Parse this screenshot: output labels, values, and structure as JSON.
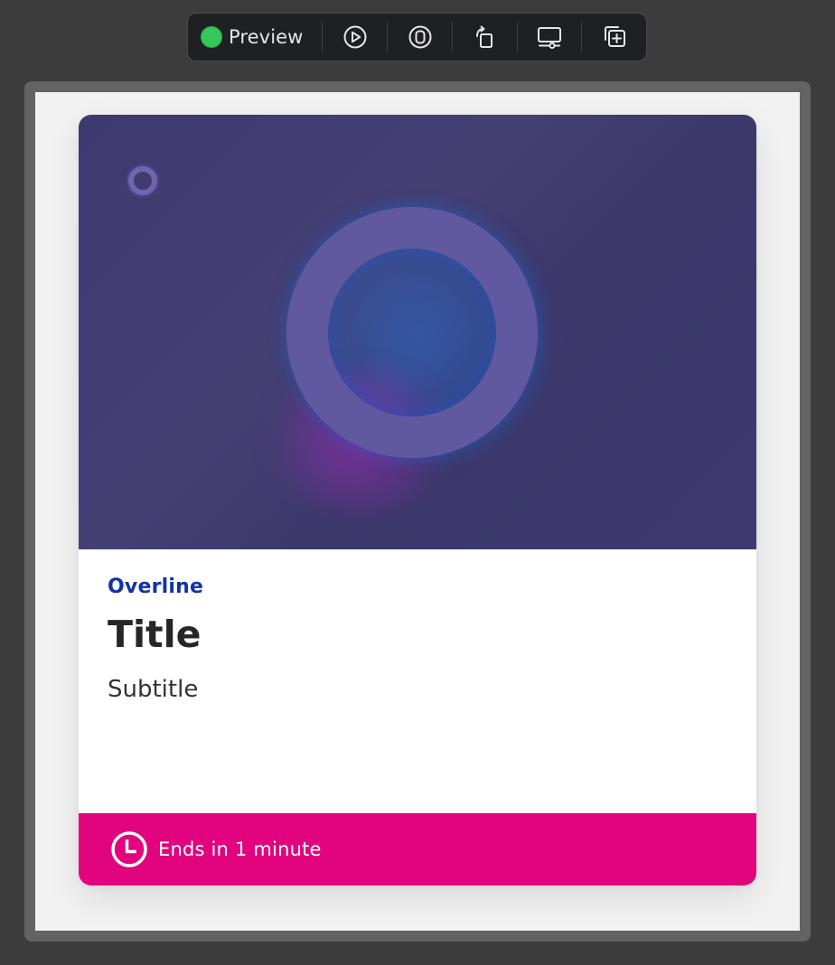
{
  "toolbar": {
    "preview_label": "Preview",
    "status_color": "#34c759",
    "buttons": [
      {
        "icon": "play-icon"
      },
      {
        "icon": "live-preview-icon"
      },
      {
        "icon": "rotate-icon"
      },
      {
        "icon": "device-settings-icon"
      },
      {
        "icon": "duplicate-icon"
      }
    ]
  },
  "card": {
    "overline": "Overline",
    "title": "Title",
    "subtitle": "Subtitle",
    "footer_text": "Ends in 1 minute",
    "footer_icon": "clock-icon",
    "colors": {
      "overline": "#1233a6",
      "footer_background": "#e2037e",
      "image_background": "#3e3a70"
    }
  }
}
